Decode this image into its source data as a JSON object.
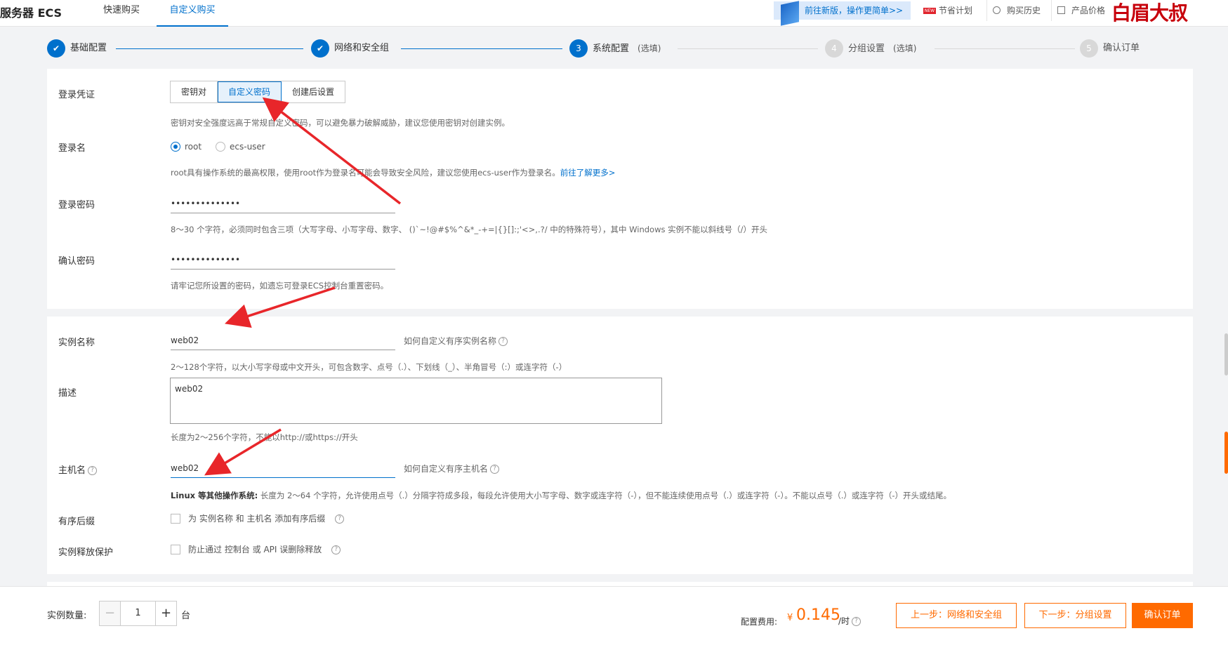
{
  "header": {
    "title": "服务器 ECS",
    "tabs": [
      "快速购买",
      "自定义购买"
    ],
    "banner": "前往新版，操作更简单>>",
    "links": [
      "节省计划",
      "购买历史",
      "产品价格"
    ],
    "new_badge": "NEW",
    "watermark": "白眉大叔"
  },
  "steps": [
    {
      "num": "1",
      "label": "基础配置",
      "option": "",
      "state": "done"
    },
    {
      "num": "2",
      "label": "网络和安全组",
      "option": "",
      "state": "done"
    },
    {
      "num": "3",
      "label": "系统配置",
      "option": "(选填)",
      "state": "current"
    },
    {
      "num": "4",
      "label": "分组设置",
      "option": "(选填)",
      "state": "todo"
    },
    {
      "num": "5",
      "label": "确认订单",
      "option": "",
      "state": "todo"
    }
  ],
  "login": {
    "credential_label": "登录凭证",
    "credential_options": [
      "密钥对",
      "自定义密码",
      "创建后设置"
    ],
    "credential_selected": "自定义密码",
    "credential_help": "密钥对安全强度远高于常规自定义密码，可以避免暴力破解威胁，建议您使用密钥对创建实例。",
    "username_label": "登录名",
    "username_options": [
      "root",
      "ecs-user"
    ],
    "username_selected": "root",
    "username_help": "root具有操作系统的最高权限，使用root作为登录名可能会导致安全风险，建议您使用ecs-user作为登录名。",
    "username_help_link": "前往了解更多>",
    "password_label": "登录密码",
    "password_value": "••••••••••••••",
    "password_help": "8～30 个字符，必须同时包含三项（大写字母、小写字母、数字、 ()`~!@#$%^&*_-+=|{}[]:;'<>,.?/ 中的特殊符号），其中 Windows 实例不能以斜线号（/）开头",
    "confirm_label": "确认密码",
    "confirm_value": "••••••••••••••",
    "confirm_help": "请牢记您所设置的密码，如遗忘可登录ECS控制台重置密码。"
  },
  "instance": {
    "name_label": "实例名称",
    "name_value": "web02",
    "name_tip": "如何自定义有序实例名称",
    "name_help": "2～128个字符，以大小写字母或中文开头，可包含数字、点号（.）、下划线（_）、半角冒号（:）或连字符（-）",
    "desc_label": "描述",
    "desc_value": "web02",
    "desc_help": "长度为2～256个字符，不能以http://或https://开头",
    "host_label": "主机名",
    "host_value": "web02",
    "host_tip": "如何自定义有序主机名",
    "host_help_bold": "Linux 等其他操作系统:",
    "host_help": "长度为 2～64 个字符，允许使用点号（.）分隔字符成多段，每段允许使用大小写字母、数字或连字符（-），但不能连续使用点号（.）或连字符（-）。不能以点号（.）或连字符（-）开头或结尾。",
    "suffix_label": "有序后缀",
    "suffix_check": "为 实例名称 和 主机名 添加有序后缀",
    "protect_label": "实例释放保护",
    "protect_check": "防止通过 控制台 或 API 误删除释放"
  },
  "footer": {
    "qty_label": "实例数量:",
    "qty_value": "1",
    "qty_unit": "台",
    "minus": "−",
    "plus": "+",
    "cost_label": "配置费用:",
    "currency": "¥",
    "cost_value": "0.145",
    "cost_unit": "/时",
    "prev_button": "上一步：网络和安全组",
    "next_button": "下一步：分组设置",
    "confirm_button": "确认订单"
  },
  "colors": {
    "accent": "#0070cc",
    "orange": "#ff6a00",
    "arrow": "#e8262a"
  }
}
